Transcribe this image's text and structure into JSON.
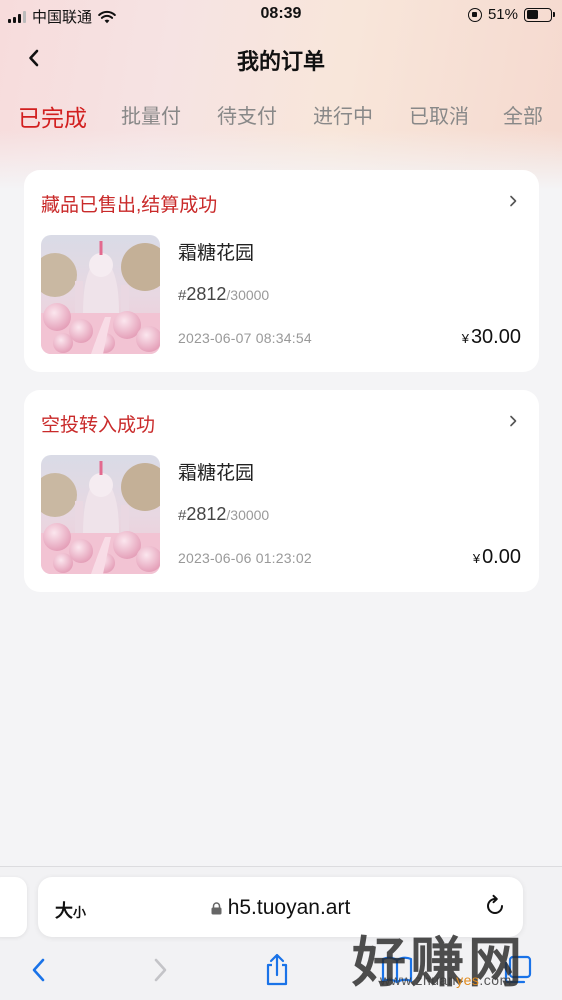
{
  "status_bar": {
    "carrier": "中国联通",
    "time": "08:39",
    "battery": "51%",
    "battery_level": 0.51
  },
  "nav": {
    "title": "我的订单",
    "back_icon": "chevron-left-icon"
  },
  "tabs": [
    {
      "label": "已完成",
      "active": true
    },
    {
      "label": "批量付",
      "active": false
    },
    {
      "label": "待支付",
      "active": false
    },
    {
      "label": "进行中",
      "active": false
    },
    {
      "label": "已取消",
      "active": false
    },
    {
      "label": "全部",
      "active": false
    }
  ],
  "orders": [
    {
      "status": "藏品已售出,结算成功",
      "name": "霜糖花园",
      "serial_prefix": "#",
      "serial": "2812",
      "serial_total": "/30000",
      "time": "2023-06-07 08:34:54",
      "currency": "¥",
      "price": "30.00"
    },
    {
      "status": "空投转入成功",
      "name": "霜糖花园",
      "serial_prefix": "#",
      "serial": "2812",
      "serial_total": "/30000",
      "time": "2023-06-06 01:23:02",
      "currency": "¥",
      "price": "0.00"
    }
  ],
  "browser": {
    "text_size_big": "大",
    "text_size_small": "小",
    "url": "h5.tuoyan.art"
  },
  "watermark": {
    "brand": "好赚网",
    "domain_prefix": "www.zhuan",
    "domain_highlight": "yes",
    "domain_suffix": ".com"
  },
  "colors": {
    "accent_red": "#d21f1f",
    "status_red": "#c92a2a",
    "ios_blue": "#1a73e8"
  }
}
